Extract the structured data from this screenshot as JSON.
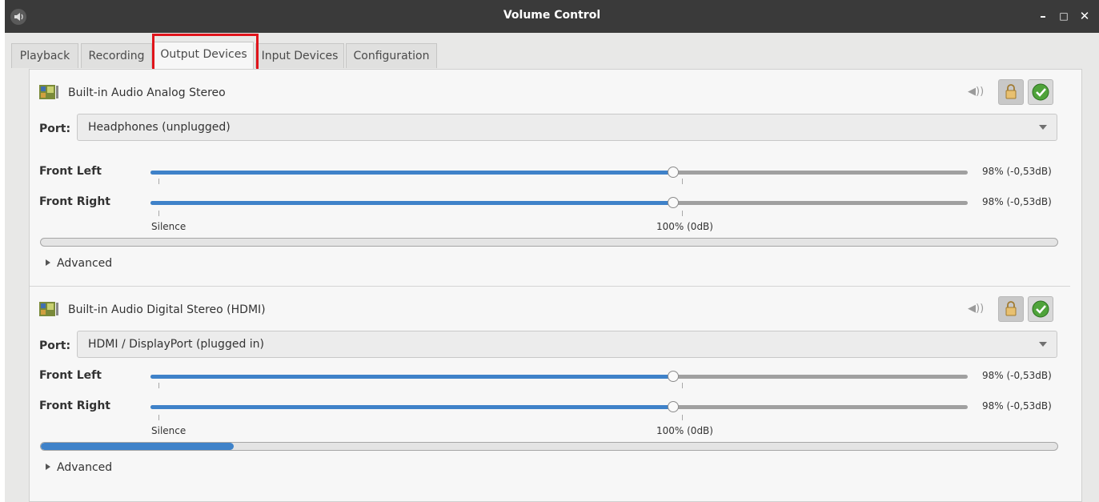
{
  "window": {
    "title": "Volume Control",
    "minimize": "–",
    "maximize": "□",
    "close": "✕"
  },
  "tabs": [
    "Playback",
    "Recording",
    "Output Devices",
    "Input Devices",
    "Configuration"
  ],
  "active_tab": "Output Devices",
  "port_label": "Port:",
  "scale": {
    "silence": "Silence",
    "full": "100% (0dB)"
  },
  "advanced_label": "Advanced",
  "devices": [
    {
      "name": "Built-in Audio Analog Stereo",
      "port": "Headphones (unplugged)",
      "channels": [
        {
          "label": "Front Left",
          "value": "98% (-0,53dB)",
          "level": 0.64
        },
        {
          "label": "Front Right",
          "value": "98% (-0,53dB)",
          "level": 0.64
        }
      ],
      "meter_level": 0.0
    },
    {
      "name": "Built-in Audio Digital Stereo (HDMI)",
      "port": "HDMI / DisplayPort (plugged in)",
      "channels": [
        {
          "label": "Front Left",
          "value": "98% (-0,53dB)",
          "level": 0.64
        },
        {
          "label": "Front Right",
          "value": "98% (-0,53dB)",
          "level": 0.64
        }
      ],
      "meter_level": 0.19
    }
  ],
  "colors": {
    "accent": "#3f82c9",
    "highlight": "#e0141b",
    "titlebar": "#3a3a3a"
  }
}
